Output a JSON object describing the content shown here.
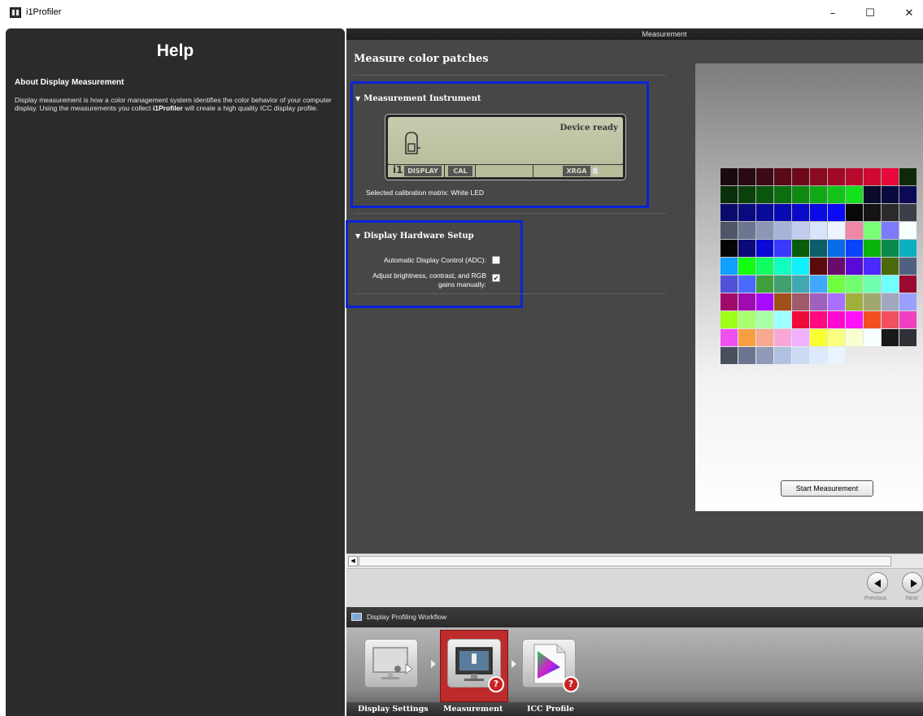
{
  "window": {
    "title": "i1Profiler",
    "minimize_glyph": "–",
    "maximize_glyph": "☐",
    "close_glyph": "✕"
  },
  "help": {
    "title": "Help",
    "heading": "About Display Measurement",
    "body_pre": "Display measurement is how a color management system identifies the color behavior of your computer display. Using the measurements you collect ",
    "body_bold": "i1Profiler",
    "body_post": " will create a high quality ICC display profile."
  },
  "main": {
    "header": "Measurement",
    "title": "Measure color patches"
  },
  "instrument": {
    "heading": "Measurement Instrument",
    "status": "Device ready",
    "brand": "i1",
    "badge_display": "DISPLAY",
    "badge_cal": "CAL",
    "badge_mode": "XRGA",
    "calibration_label": "Selected calibration matrix:  White LED"
  },
  "hardware": {
    "heading": "Display Hardware Setup",
    "adc_label": "Automatic Display Control (ADC):",
    "adc_checked": false,
    "manual_label_1": "Adjust brightness, contrast, and RGB",
    "manual_label_2": "gains manually:",
    "manual_checked": true,
    "check_glyph": "✔"
  },
  "patches": {
    "start_button": "Start Measurement",
    "colors": [
      "#1a0a0f",
      "#2a0a12",
      "#3b0a15",
      "#590a19",
      "#70081b",
      "#8a0a20",
      "#a10a25",
      "#b80a2a",
      "#d00a30",
      "#e8083a",
      "#0f2a0a",
      "#0a2f0a",
      "#0a400a",
      "#0a560c",
      "#0c6f0f",
      "#0e8a12",
      "#10a816",
      "#12c41a",
      "#14e01e",
      "#0a0a2a",
      "#0a0a3f",
      "#0a0a55",
      "#0a0a6b",
      "#0a0a80",
      "#0a0a9a",
      "#0a0ab4",
      "#0a0acb",
      "#0a0ae3",
      "#0a0af8",
      "#080808",
      "#141414",
      "#2a2a2a",
      "#3a3f4a",
      "#4e5668",
      "#6b7691",
      "#8c97b3",
      "#a6b4d8",
      "#c1cdf0",
      "#d9e4fb",
      "#eef4ff",
      "#f087a8",
      "#7bff7b",
      "#7b7bff",
      "#f8ffff",
      "#050505",
      "#0a0a7a",
      "#0a0ad8",
      "#3a3aff",
      "#0a5c0a",
      "#0a5f6b",
      "#0a6be8",
      "#0a44ff",
      "#0ab40a",
      "#0a8a4a",
      "#0ab0c0",
      "#10a0ff",
      "#10ff10",
      "#10ff60",
      "#10ffc0",
      "#10f0ff",
      "#5a0a0a",
      "#6a0a6a",
      "#5a0ad8",
      "#4a2aff",
      "#4a6a0a",
      "#506080",
      "#5050d8",
      "#4a6aff",
      "#40a040",
      "#40a070",
      "#40a8b0",
      "#40a8ff",
      "#70ff40",
      "#70ff70",
      "#70ffb0",
      "#70ffff",
      "#9a0a30",
      "#a00a6a",
      "#a00ab0",
      "#a80aff",
      "#a0501a",
      "#a05a6a",
      "#a060c0",
      "#a870ff",
      "#a0b03a",
      "#a0a870",
      "#a0a8c0",
      "#9aa0ff",
      "#a0ff1a",
      "#a8ff70",
      "#a8ffa8",
      "#a0ffff",
      "#f00a3a",
      "#ff0a80",
      "#ff0ad0",
      "#ff10ff",
      "#f05020",
      "#f05060",
      "#f040c0",
      "#f050f0",
      "#f8a040",
      "#f8a890",
      "#f8a8d8",
      "#f0b0ff",
      "#f8ff30",
      "#f8ff80",
      "#f8ffd0",
      "#f8ffff",
      "#181818",
      "#2f3038",
      "#4a4f5e",
      "#6c7590",
      "#8e9ab8",
      "#b0c0e0",
      "#ccdaf4",
      "#dde9fc",
      "#eaf4ff"
    ]
  },
  "navigation": {
    "previous": "Previous",
    "next": "Next"
  },
  "workflow": {
    "title": "Display Profiling Workflow",
    "steps": [
      {
        "label": "Display Settings"
      },
      {
        "label": "Measurement"
      },
      {
        "label": "ICC Profile"
      }
    ],
    "help_badge": "?"
  }
}
